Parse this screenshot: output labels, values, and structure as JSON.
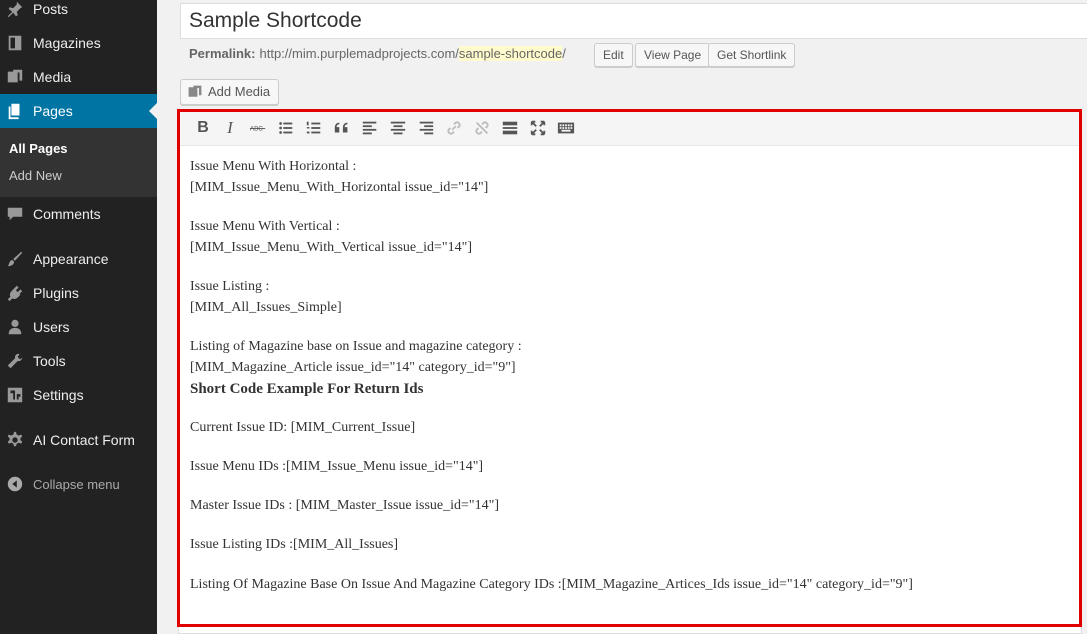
{
  "sidebar": {
    "items": [
      {
        "label": "Posts",
        "icon": "pin-icon"
      },
      {
        "label": "Magazines",
        "icon": "book-icon"
      },
      {
        "label": "Media",
        "icon": "media-icon"
      },
      {
        "label": "Pages",
        "icon": "pages-icon"
      },
      {
        "label": "Comments",
        "icon": "comment-icon"
      },
      {
        "label": "Appearance",
        "icon": "brush-icon"
      },
      {
        "label": "Plugins",
        "icon": "plug-icon"
      },
      {
        "label": "Users",
        "icon": "user-icon"
      },
      {
        "label": "Tools",
        "icon": "wrench-icon"
      },
      {
        "label": "Settings",
        "icon": "settings-icon"
      },
      {
        "label": "AI Contact Form",
        "icon": "gear-icon"
      }
    ],
    "submenu": [
      "All Pages",
      "Add New"
    ],
    "collapse": "Collapse menu",
    "active_color": "#0074a2"
  },
  "post": {
    "title": "Sample Shortcode",
    "permalink_label": "Permalink:",
    "permalink_base": "http://mim.purplemadprojects.com/",
    "permalink_slug": "sample-shortcode",
    "permalink_end": "/",
    "edit_button": "Edit",
    "view_button": "View Page",
    "shortlink_button": "Get Shortlink",
    "add_media": "Add Media"
  },
  "editor": {
    "lines": [
      "Issue Menu With Horizontal :",
      "[MIM_Issue_Menu_With_Horizontal issue_id=\"14\"]",
      "Issue Menu With Vertical :",
      "[MIM_Issue_Menu_With_Vertical issue_id=\"14\"]",
      "Issue  Listing :",
      "[MIM_All_Issues_Simple]",
      "Listing of Magazine base on Issue and magazine category :",
      "[MIM_Magazine_Article issue_id=\"14\" category_id=\"9\"]",
      "Short Code Example For Return Ids",
      "Current Issue ID: [MIM_Current_Issue]",
      "Issue Menu IDs :[MIM_Issue_Menu issue_id=\"14\"]",
      "Master Issue IDs : [MIM_Master_Issue issue_id=\"14\"]",
      "Issue Listing IDs :[MIM_All_Issues]",
      "Listing Of Magazine Base On Issue And Magazine Category IDs :[MIM_Magazine_Artices_Ids issue_id=\"14\" category_id=\"9\"]"
    ]
  },
  "highlight_color": "#e00000"
}
